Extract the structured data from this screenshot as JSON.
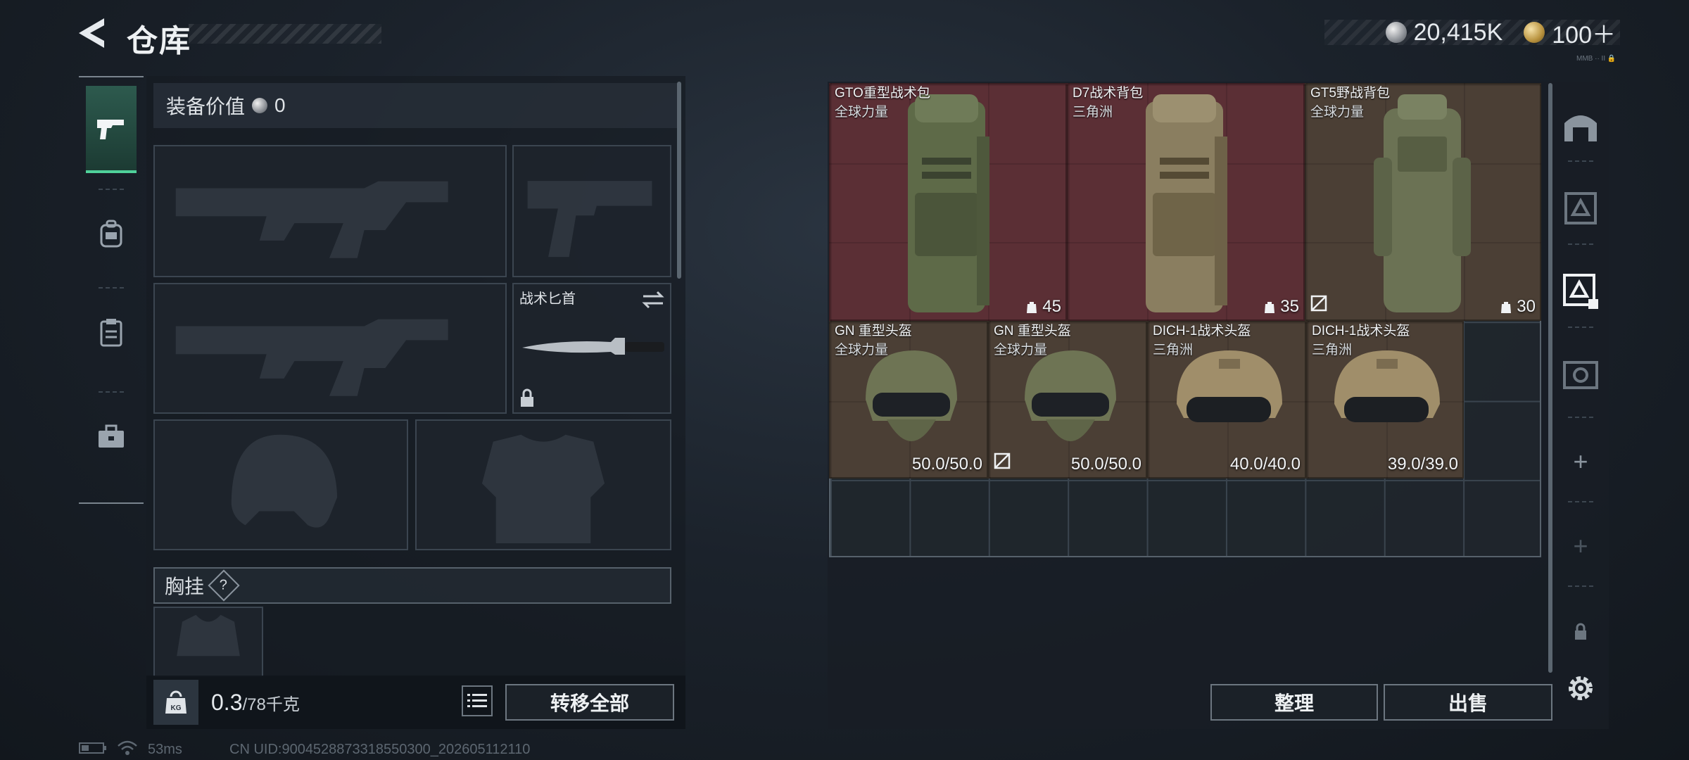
{
  "header": {
    "title": "仓库",
    "currency_main": "20,415K",
    "currency_secondary": "100＋",
    "tiny_mark": "MMB ·· II 🔒"
  },
  "left_rail": {
    "tabs": [
      {
        "icon": "pistol-icon",
        "active": true
      },
      {
        "icon": "backpack-tab-icon",
        "active": false
      },
      {
        "icon": "clipboard-icon",
        "active": false
      },
      {
        "icon": "toolbox-icon",
        "active": false
      }
    ]
  },
  "equipment": {
    "value_label": "装备价值",
    "value": "0",
    "knife_label": "战术匕首",
    "chest_label": "胸挂",
    "chest_help": "?"
  },
  "weight": {
    "current": "0.3",
    "max": "/78千克",
    "kg_label": "KG"
  },
  "buttons": {
    "transfer_all": "转移全部",
    "organize": "整理",
    "sell": "出售"
  },
  "stash": {
    "backpacks": [
      {
        "name": "GTO重型战术包",
        "sub": "全球力量",
        "stat": "45",
        "bg": "red"
      },
      {
        "name": "D7战术背包",
        "sub": "三角洲",
        "stat": "35",
        "bg": "red"
      },
      {
        "name": "GT5野战背包",
        "sub": "全球力量",
        "stat": "30",
        "bg": "brown"
      }
    ],
    "helmets": [
      {
        "name": "GN 重型头盔",
        "sub": "全球力量",
        "stat": "50.0/50.0"
      },
      {
        "name": "GN 重型头盔",
        "sub": "全球力量",
        "stat": "50.0/50.0"
      },
      {
        "name": "DICH-1战术头盔",
        "sub": "三角洲",
        "stat": "40.0/40.0"
      },
      {
        "name": "DICH-1战术头盔",
        "sub": "三角洲",
        "stat": "39.0/39.0"
      }
    ]
  },
  "right_rail": {
    "plus_1": "+",
    "plus_2": "+"
  },
  "status": {
    "ping": "53ms",
    "uid": "CN UID:9004528873318550300_202605112110"
  },
  "colors": {
    "accent_green": "#4fd19a",
    "item_red": "#5b2f35",
    "item_brown": "#4b3f35"
  }
}
